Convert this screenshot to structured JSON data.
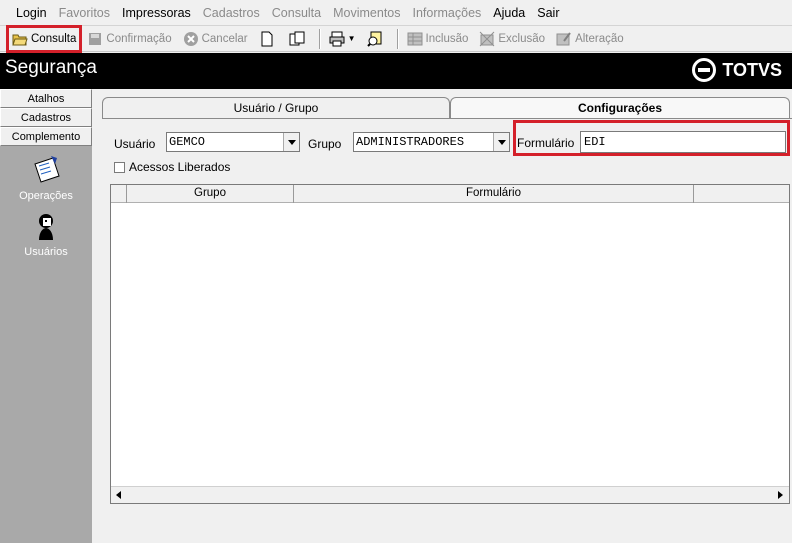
{
  "menu": {
    "items": [
      {
        "label": "Login",
        "enabled": true
      },
      {
        "label": "Favoritos",
        "enabled": false
      },
      {
        "label": "Impressoras",
        "enabled": true
      },
      {
        "label": "Cadastros",
        "enabled": false
      },
      {
        "label": "Consulta",
        "enabled": false
      },
      {
        "label": "Movimentos",
        "enabled": false
      },
      {
        "label": "Informações",
        "enabled": false
      },
      {
        "label": "Ajuda",
        "enabled": true
      },
      {
        "label": "Sair",
        "enabled": true
      }
    ]
  },
  "toolbar": {
    "consulta": "Consulta",
    "confirmacao": "Confirmação",
    "cancelar": "Cancelar",
    "inclusao": "Inclusão",
    "exclusao": "Exclusão",
    "alteracao": "Alteração"
  },
  "header": {
    "title": "Segurança",
    "logo_text": "TOTVS"
  },
  "sidebar": {
    "tabs": [
      "Atalhos",
      "Cadastros",
      "Complemento"
    ],
    "tools": [
      {
        "label": "Operações",
        "icon": "operations-icon"
      },
      {
        "label": "Usuários",
        "icon": "users-icon"
      }
    ]
  },
  "tabs": {
    "usuario_grupo": "Usuário  / Grupo",
    "configuracoes": "Configurações"
  },
  "form": {
    "usuario_label": "Usuário",
    "usuario_value": "GEMCO",
    "grupo_label": "Grupo",
    "grupo_value": "ADMINISTRADORES",
    "formulario_label": "Formulário",
    "formulario_value": "EDI",
    "acessos_label": "Acessos Liberados"
  },
  "grid": {
    "columns": [
      "Grupo",
      "Formulário"
    ]
  },
  "colors": {
    "highlight": "#d4202a",
    "header_bg": "#000000",
    "sidebar_bg": "#a9a9a9"
  }
}
